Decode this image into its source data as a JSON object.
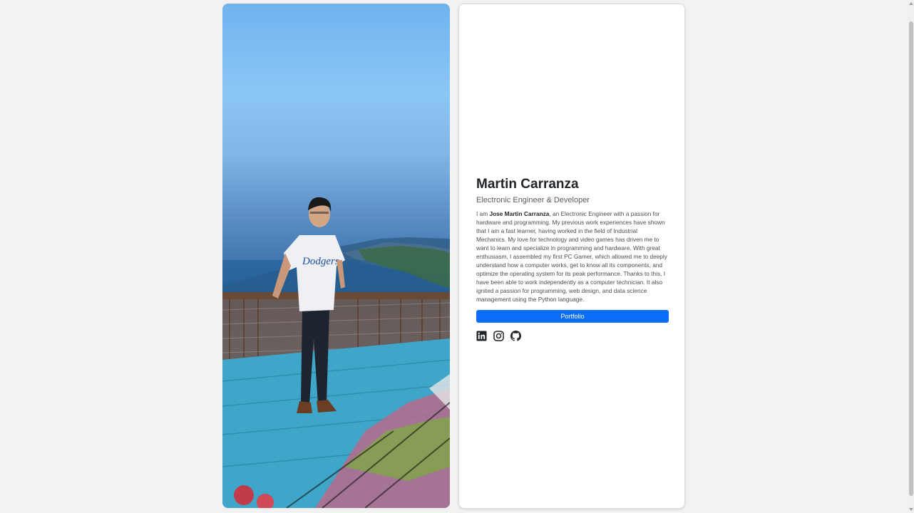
{
  "profile": {
    "name": "Martin Carranza",
    "role": "Electronic Engineer & Developer",
    "bio_prefix": "I am ",
    "bio_name": "Jose Martin Carranza",
    "bio_rest": ", an Electronic Engineer with a passion for hardware and programming. My previous work experiences have shown that I am a fast learner, having worked in the field of Industrial Mechanics. My love for technology and video games has driven me to want to learn and specialize in programming and hardware. With great enthusiasm, I assembled my first PC Gamer, which allowed me to deeply understand how a computer works, get to know all its components, and optimize the operating system for its peak performance. Thanks to this, I have been able to work independently as a computer technician. It also ignited a passion for programming, web design, and data science management using the Python language.",
    "button_label": "Portfolio"
  },
  "socials": [
    {
      "icon": "linkedin-icon"
    },
    {
      "icon": "instagram-icon"
    },
    {
      "icon": "github-icon"
    }
  ],
  "colors": {
    "accent": "#0d6efd",
    "page_bg": "#f2f2f2",
    "card_bg": "#ffffff"
  }
}
